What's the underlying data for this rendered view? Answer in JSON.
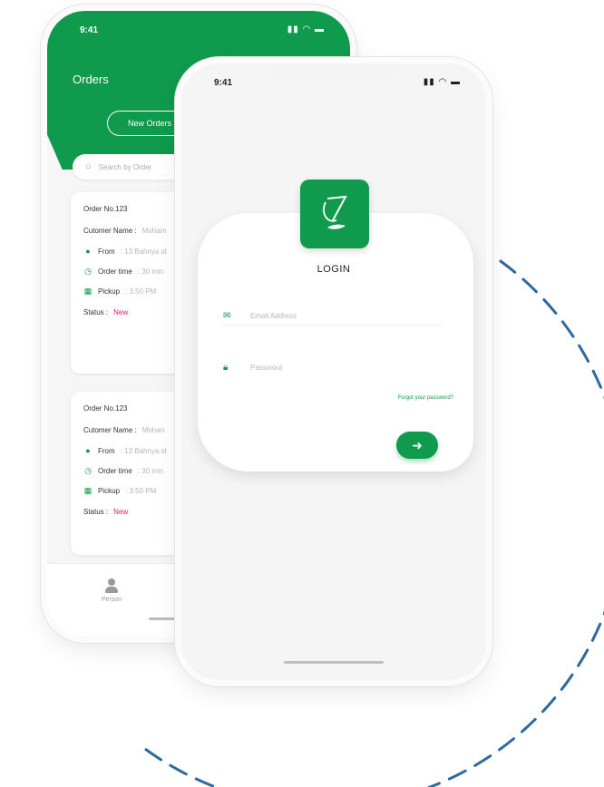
{
  "back_phone": {
    "status_time": "9:41",
    "title": "Orders",
    "new_orders_label": "New Orders",
    "search_placeholder": "Search by Order",
    "orders": [
      {
        "order_no": "Order No.123",
        "customer_label": "Cutomer Name :",
        "customer_value": "Moham",
        "from_label": "From",
        "from_value": ": 13 Bahnya st",
        "time_label": "Order time",
        "time_value": ": 30 min",
        "pickup_label": "Pickup",
        "pickup_value": ": 3:50 PM",
        "status_label": "Status :",
        "status_value": "New"
      },
      {
        "order_no": "Order No.123",
        "customer_label": "Cutomer Name :",
        "customer_value": "Mohan",
        "from_label": "From",
        "from_value": ": 13 Bahnya st",
        "time_label": "Order time",
        "time_value": ": 30 min",
        "pickup_label": "Pickup",
        "pickup_value": ": 3:50 PM",
        "status_label": "Status :",
        "status_value": "New"
      }
    ],
    "tab_label": "Person"
  },
  "front_phone": {
    "status_time": "9:41",
    "login_title": "LOGIN",
    "email_placeholder": "Email Address",
    "password_placeholder": "Password",
    "forgot_label": "Forgot your password?",
    "submit_arrow": "➜"
  },
  "colors": {
    "brand_green": "#0f9a4d",
    "status_new": "#e0245e",
    "arc_blue": "#2e6aa0"
  },
  "icons": [
    "wifi-signal-icon",
    "battery-icon",
    "search-icon",
    "location-pin-icon",
    "clock-icon",
    "calendar-icon",
    "person-icon",
    "email-icon",
    "lock-icon",
    "arrow-right-icon"
  ]
}
